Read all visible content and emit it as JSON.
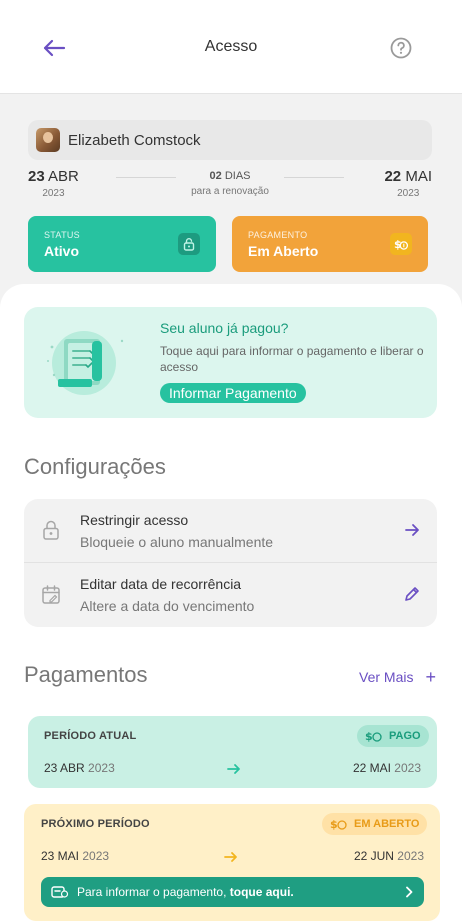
{
  "header": {
    "title": "Acesso",
    "back_icon": "arrow-left-icon",
    "help_icon": "question-circle-icon",
    "accent": "#6a4fc3"
  },
  "student": {
    "name": "Elizabeth Comstock",
    "avatar_icon": "avatar"
  },
  "period": {
    "start_day": "23",
    "start_month": "ABR",
    "start_year": "2023",
    "days_count": "02",
    "days_label": "DIAS",
    "renewal_label": "para a renovação",
    "end_day": "22",
    "end_month": "MAI",
    "end_year": "2023"
  },
  "status_card": {
    "caption": "STATUS",
    "value": "Ativo",
    "icon": "unlock-icon",
    "color": "#27c2a0"
  },
  "payment_card": {
    "caption": "PAGAMENTO",
    "value": "Em Aberto",
    "icon": "money-icon",
    "color": "#f2a33a"
  },
  "promo": {
    "title": "Seu aluno já pagou?",
    "text": "Toque aqui para informar o pagamento e liberar o acesso",
    "button": "Informar Pagamento",
    "illustration_icon": "receipt-illustration-icon"
  },
  "settings": {
    "title": "Configurações",
    "items": [
      {
        "title": "Restringir acesso",
        "subtitle": "Bloqueie o aluno manualmente",
        "icon": "lock-icon",
        "action_icon": "arrow-right-icon"
      },
      {
        "title": "Editar data de recorrência",
        "subtitle": "Altere a data do vencimento",
        "icon": "calendar-edit-icon",
        "action_icon": "pencil-icon"
      }
    ]
  },
  "payments": {
    "title": "Pagamentos",
    "see_more": "Ver Mais",
    "see_more_icon": "plus-icon",
    "current": {
      "label": "PERÍODO ATUAL",
      "badge": "PAGO",
      "badge_color": "#1a9c7c",
      "start": "23 ABR",
      "start_year": "2023",
      "end": "22 MAI",
      "end_year": "2023"
    },
    "next": {
      "label": "PRÓXIMO PERÍODO",
      "badge": "EM ABERTO",
      "badge_color": "#e89b18",
      "start": "23 MAI",
      "start_year": "2023",
      "end": "22 JUN",
      "end_year": "2023",
      "cta_text": "Para informar o pagamento,",
      "cta_bold": "toque aqui."
    }
  }
}
